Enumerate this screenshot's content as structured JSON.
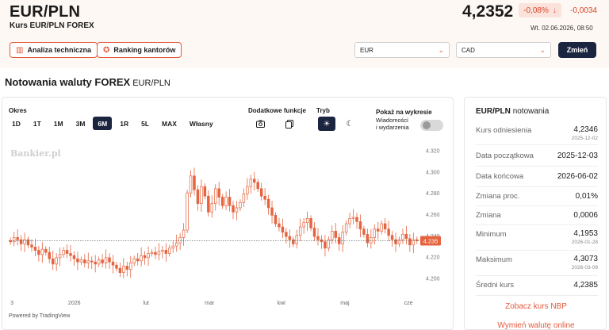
{
  "header": {
    "pair": "EUR/PLN",
    "subtitle": "Kurs EUR/PLN FOREX",
    "price": "4,2352",
    "change_pct": "-0,08%",
    "change_abs": "-0,0034",
    "datetime": "Wt. 02.06.2026, 08:50",
    "btn_analysis": "Analiza techniczna",
    "btn_ranking": "Ranking kantorów",
    "select_from": "EUR",
    "select_to": "CAD",
    "btn_change": "Zmień"
  },
  "section": {
    "title": "Notowania waluty FOREX",
    "suffix": "EUR/PLN"
  },
  "controls": {
    "range_label": "Okres",
    "ranges": [
      "1D",
      "1T",
      "1M",
      "3M",
      "6M",
      "1R",
      "5L",
      "MAX",
      "Własny"
    ],
    "active_range": "6M",
    "extra_label": "Dodatkowe funkcje",
    "mode_label": "Tryb",
    "show_label": "Pokaż na wykresie",
    "news_label_1": "Wiadomości",
    "news_label_2": "i wydarzenia"
  },
  "chart_watermark": "Bankier.pl",
  "powered_by": "Powered by TradingView",
  "colors": {
    "accent": "#e35a3c",
    "dark": "#1c2540",
    "candle": "#e4643f"
  },
  "chart_data": {
    "type": "candlestick",
    "symbol": "EUR/PLN",
    "y_ticks": [
      "4.320",
      "4.300",
      "4.280",
      "4.260",
      "4.240",
      "4.220",
      "4.200"
    ],
    "ylim": [
      4.192,
      4.322
    ],
    "x_ticks": [
      "3",
      "2026",
      "lut",
      "mar",
      "kwi",
      "maj",
      "cze"
    ],
    "last_price": "4.235",
    "close_series": [
      4.234,
      4.238,
      4.236,
      4.232,
      4.236,
      4.231,
      4.229,
      4.226,
      4.222,
      4.227,
      4.224,
      4.218,
      4.213,
      4.219,
      4.222,
      4.226,
      4.223,
      4.221,
      4.218,
      4.215,
      4.217,
      4.214,
      4.216,
      4.215,
      4.213,
      4.217,
      4.214,
      4.219,
      4.215,
      4.212,
      4.209,
      4.205,
      4.211,
      4.208,
      4.214,
      4.218,
      4.216,
      4.221,
      4.219,
      4.223,
      4.224,
      4.222,
      4.225,
      4.226,
      4.223,
      4.228,
      4.23,
      4.233,
      4.238,
      4.245,
      4.28,
      4.296,
      4.283,
      4.27,
      4.286,
      4.277,
      4.262,
      4.27,
      4.284,
      4.276,
      4.268,
      4.276,
      4.268,
      4.262,
      4.266,
      4.271,
      4.279,
      4.286,
      4.293,
      4.29,
      4.284,
      4.277,
      4.274,
      4.266,
      4.259,
      4.251,
      4.248,
      4.243,
      4.239,
      4.236,
      4.232,
      4.24,
      4.248,
      4.252,
      4.256,
      4.247,
      4.239,
      4.236,
      4.234,
      4.228,
      4.236,
      4.244,
      4.238,
      4.232,
      4.243,
      4.251,
      4.256,
      4.257,
      4.253,
      4.246,
      4.241,
      4.233,
      4.238,
      4.246,
      4.244,
      4.251,
      4.246,
      4.24,
      4.236,
      4.232,
      4.236,
      4.241,
      4.237,
      4.231,
      4.236,
      4.235
    ]
  },
  "stats": {
    "title_bold": "EUR/PLN",
    "title_rest": "notowania",
    "rows": [
      {
        "label": "Kurs odniesienia",
        "value": "4,2346",
        "date": "2025-12-02"
      },
      {
        "label": "Data początkowa",
        "value": "2025-12-03",
        "date": ""
      },
      {
        "label": "Data końcowa",
        "value": "2026-06-02",
        "date": ""
      },
      {
        "label": "Zmiana proc.",
        "value": "0,01%",
        "date": ""
      },
      {
        "label": "Zmiana",
        "value": "0,0006",
        "date": ""
      },
      {
        "label": "Minimum",
        "value": "4,1953",
        "date": "2026-01-28"
      },
      {
        "label": "Maksimum",
        "value": "4,3073",
        "date": "2026-03-09"
      },
      {
        "label": "Średni kurs",
        "value": "4,2385",
        "date": ""
      }
    ],
    "link_nbp": "Zobacz kurs NBP",
    "link_exchange": "Wymień walutę online"
  }
}
